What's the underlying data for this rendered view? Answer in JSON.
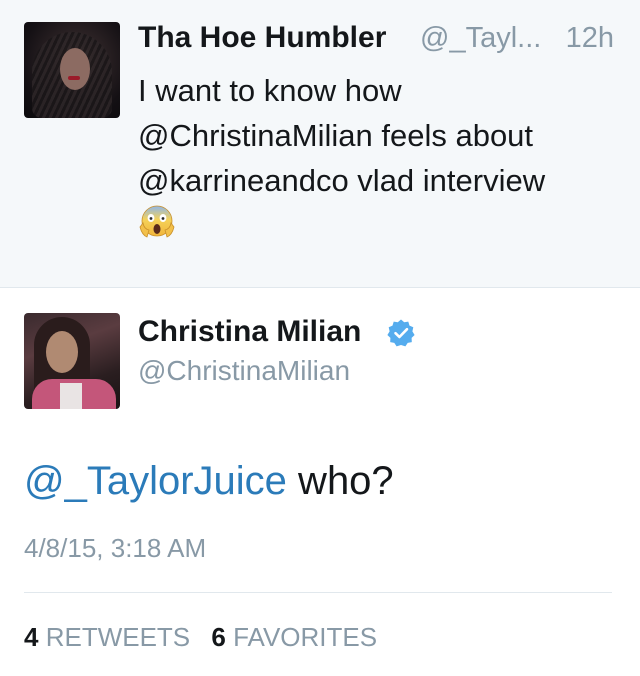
{
  "parent_tweet": {
    "display_name": "Tha Hoe Humbler",
    "handle": "@_Tayl...",
    "time": "12h",
    "text_lines": [
      "I want to know how",
      "@ChristinaMilian feels about",
      "@karrineandco vlad interview"
    ],
    "emoji": "face-screaming-in-fear-emoji"
  },
  "main_tweet": {
    "display_name": "Christina Milian",
    "verified": true,
    "handle": "@ChristinaMilian",
    "mention": "@_TaylorJuice",
    "text": " who?",
    "timestamp": "4/8/15, 3:18 AM",
    "retweets_count": "4",
    "retweets_label": "RETWEETS",
    "favorites_count": "6",
    "favorites_label": "FAVORITES"
  },
  "colors": {
    "link": "#2b7bb9",
    "muted": "#8899a6",
    "text": "#14171a",
    "parent_background": "#f5f8fa",
    "verified_badge": "#55acee"
  }
}
